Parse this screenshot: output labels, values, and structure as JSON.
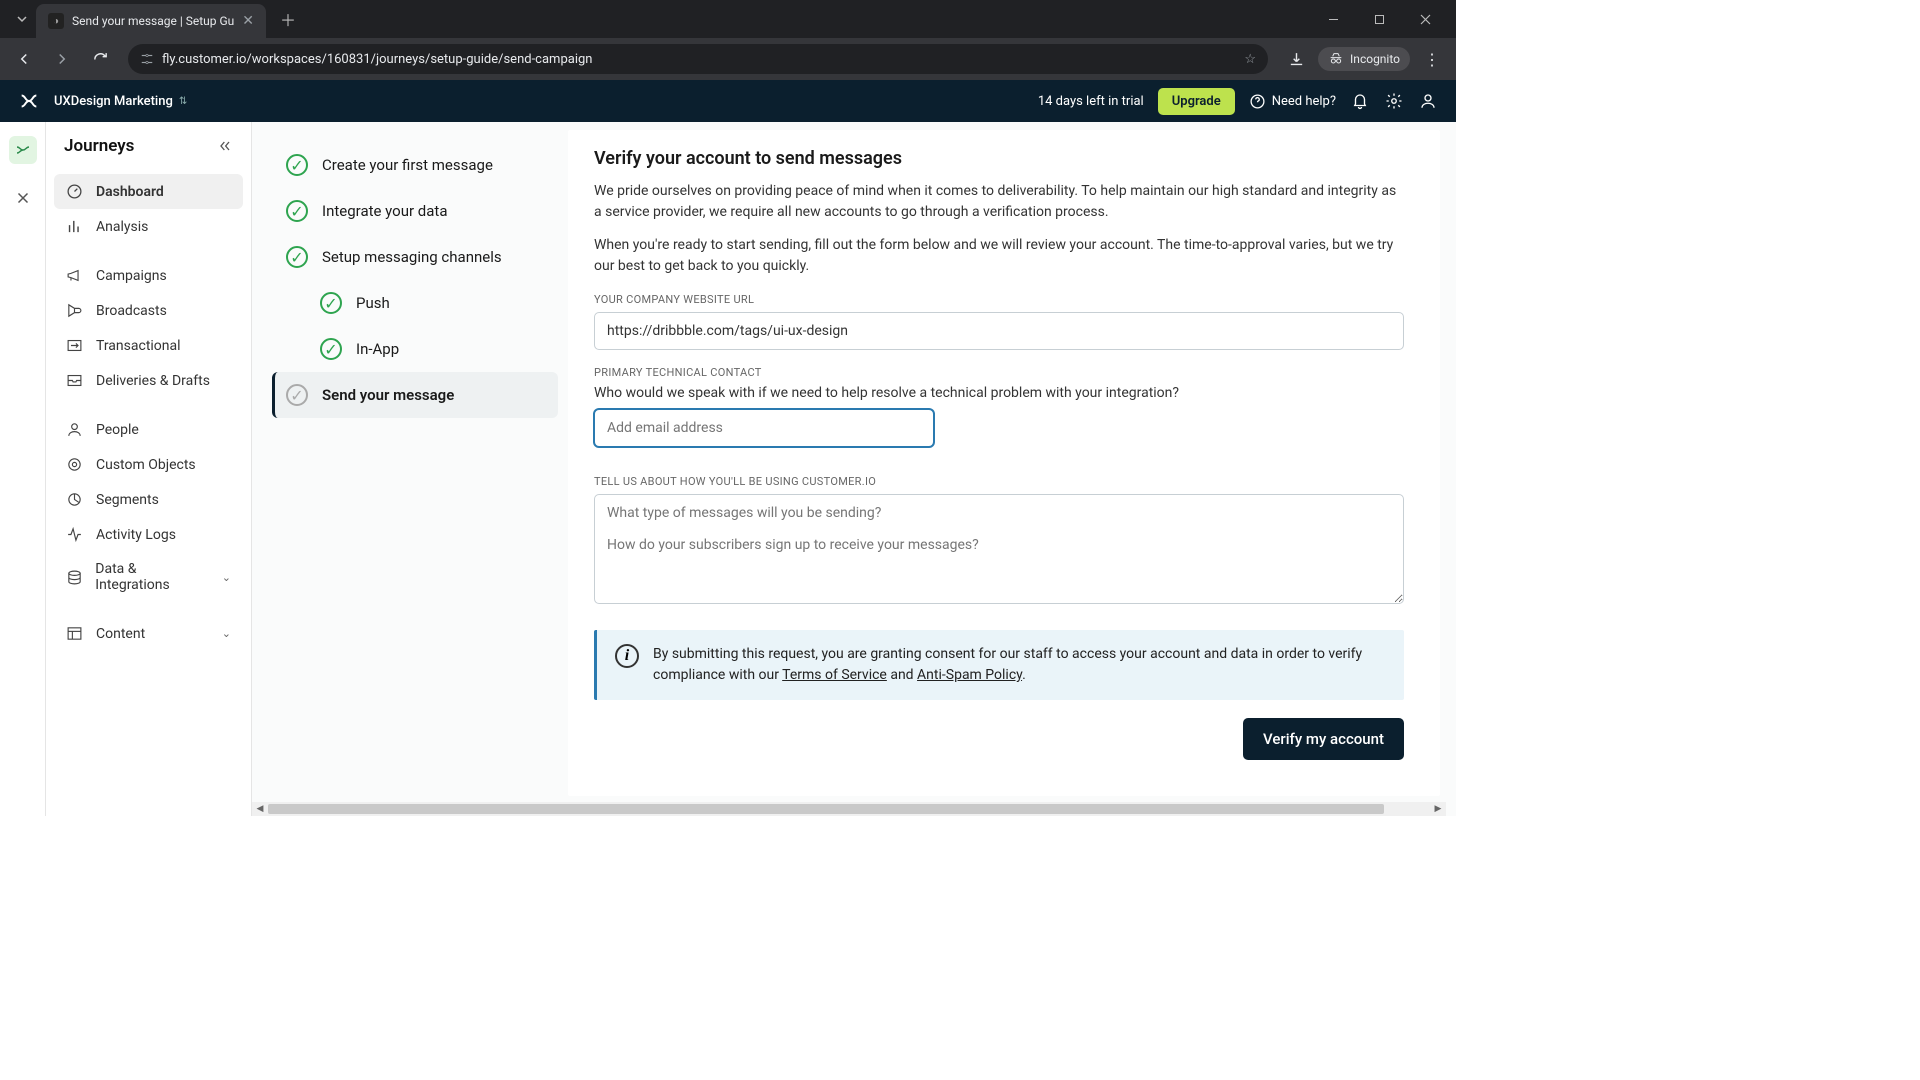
{
  "browser": {
    "tab_title": "Send your message | Setup Gu",
    "url": "fly.customer.io/workspaces/160831/journeys/setup-guide/send-campaign",
    "incognito_label": "Incognito"
  },
  "topbar": {
    "workspace_name": "UXDesign Marketing",
    "trial_text": "14 days left in trial",
    "upgrade_label": "Upgrade",
    "help_label": "Need help?"
  },
  "sidebar": {
    "title": "Journeys",
    "nav": [
      {
        "label": "Dashboard",
        "active": true
      },
      {
        "label": "Analysis"
      },
      {
        "label": "Campaigns"
      },
      {
        "label": "Broadcasts"
      },
      {
        "label": "Transactional"
      },
      {
        "label": "Deliveries & Drafts"
      },
      {
        "label": "People"
      },
      {
        "label": "Custom Objects"
      },
      {
        "label": "Segments"
      },
      {
        "label": "Activity Logs"
      },
      {
        "label": "Data & Integrations",
        "expandable": true
      },
      {
        "label": "Content",
        "expandable": true
      }
    ]
  },
  "steps": [
    {
      "label": "Create your first message",
      "done": true
    },
    {
      "label": "Integrate your data",
      "done": true
    },
    {
      "label": "Setup messaging channels",
      "done": true
    },
    {
      "label": "Push",
      "done": true,
      "sub": true
    },
    {
      "label": "In-App",
      "done": true,
      "sub": true
    },
    {
      "label": "Send your message",
      "done": false,
      "selected": true
    }
  ],
  "form": {
    "title": "Verify your account to send messages",
    "para1": "We pride ourselves on providing peace of mind when it comes to deliverability. To help maintain our high standard and integrity as a service provider, we require all new accounts to go through a verification process.",
    "para2": "When you're ready to start sending, fill out the form below and we will review your account. The time-to-approval varies, but we try our best to get back to you quickly.",
    "website_label": "YOUR COMPANY WEBSITE URL",
    "website_value": "https://dribbble.com/tags/ui-ux-design",
    "contact_label": "PRIMARY TECHNICAL CONTACT",
    "contact_helper": "Who would we speak with if we need to help resolve a technical problem with your integration?",
    "contact_placeholder": "Add email address",
    "usage_label": "TELL US ABOUT HOW YOU'LL BE USING CUSTOMER.IO",
    "usage_placeholder": "What type of messages will you be sending?\n\nHow do your subscribers sign up to receive your messages?",
    "consent_prefix": "By submitting this request, you are granting consent for our staff to access your account and data in order to verify compliance with our ",
    "tos_label": "Terms of Service",
    "consent_and": " and ",
    "spam_label": "Anti-Spam Policy",
    "consent_suffix": ".",
    "submit_label": "Verify my account"
  }
}
